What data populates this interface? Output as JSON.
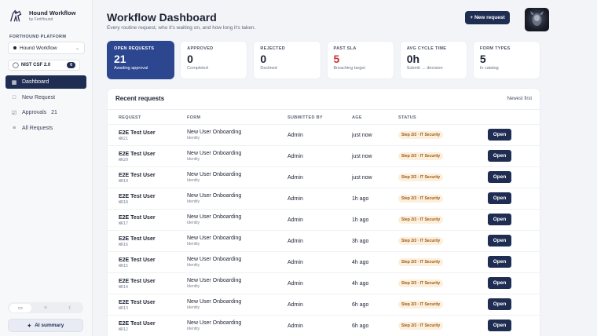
{
  "brand": {
    "name": "Hound Workflow",
    "sub": "by FortHound"
  },
  "sidebar": {
    "section_label": "FORTHOUND PLATFORM",
    "platform_select": "Hound Workflow",
    "nist": {
      "label": "NIST CSF 2.0",
      "badge": "6"
    },
    "items": [
      {
        "label": "Dashboard",
        "icon": "grid-icon"
      },
      {
        "label": "New Request",
        "icon": "document-plus-icon"
      },
      {
        "label": "Approvals",
        "count": "21",
        "icon": "check-box-icon"
      },
      {
        "label": "All Requests",
        "icon": "list-icon"
      }
    ],
    "ai_summary": "AI summary"
  },
  "header": {
    "title": "Workflow Dashboard",
    "subtitle": "Every routine request, who it's waiting on, and how long it's taken.",
    "new_request": "+ New request"
  },
  "cards": [
    {
      "label": "OPEN REQUESTS",
      "value": "21",
      "sub": "Awaiting approval"
    },
    {
      "label": "APPROVED",
      "value": "0",
      "sub": "Completed"
    },
    {
      "label": "REJECTED",
      "value": "0",
      "sub": "Declined"
    },
    {
      "label": "PAST SLA",
      "value": "5",
      "sub": "Breaching target"
    },
    {
      "label": "AVG CYCLE TIME",
      "value": "0h",
      "sub": "Submit → decision"
    },
    {
      "label": "FORM TYPES",
      "value": "5",
      "sub": "In catalog"
    }
  ],
  "table": {
    "title": "Recent requests",
    "sort": "Newest first",
    "columns": [
      "REQUEST",
      "FORM",
      "SUBMITTED BY",
      "AGE",
      "STATUS"
    ],
    "open_label": "Open",
    "rows": [
      {
        "name": "E2E Test User",
        "id": "WR21",
        "form": "New User Onboarding",
        "category": "Identity",
        "by": "Admin",
        "age": "just now",
        "status": "Step 2/3 · IT Security"
      },
      {
        "name": "E2E Test User",
        "id": "WR20",
        "form": "New User Onboarding",
        "category": "Identity",
        "by": "Admin",
        "age": "just now",
        "status": "Step 2/3 · IT Security"
      },
      {
        "name": "E2E Test User",
        "id": "WR19",
        "form": "New User Onboarding",
        "category": "Identity",
        "by": "Admin",
        "age": "just now",
        "status": "Step 2/3 · IT Security"
      },
      {
        "name": "E2E Test User",
        "id": "WR18",
        "form": "New User Onboarding",
        "category": "Identity",
        "by": "Admin",
        "age": "1h ago",
        "status": "Step 2/3 · IT Security"
      },
      {
        "name": "E2E Test User",
        "id": "WR17",
        "form": "New User Onboarding",
        "category": "Identity",
        "by": "Admin",
        "age": "1h ago",
        "status": "Step 2/3 · IT Security"
      },
      {
        "name": "E2E Test User",
        "id": "WR16",
        "form": "New User Onboarding",
        "category": "Identity",
        "by": "Admin",
        "age": "3h ago",
        "status": "Step 2/3 · IT Security"
      },
      {
        "name": "E2E Test User",
        "id": "WR15",
        "form": "New User Onboarding",
        "category": "Identity",
        "by": "Admin",
        "age": "4h ago",
        "status": "Step 2/3 · IT Security"
      },
      {
        "name": "E2E Test User",
        "id": "WR14",
        "form": "New User Onboarding",
        "category": "Identity",
        "by": "Admin",
        "age": "4h ago",
        "status": "Step 2/3 · IT Security"
      },
      {
        "name": "E2E Test User",
        "id": "WR13",
        "form": "New User Onboarding",
        "category": "Identity",
        "by": "Admin",
        "age": "6h ago",
        "status": "Step 2/3 · IT Security"
      },
      {
        "name": "E2E Test User",
        "id": "WR12",
        "form": "New User Onboarding",
        "category": "Identity",
        "by": "Admin",
        "age": "6h ago",
        "status": "Step 2/3 · IT Security"
      }
    ]
  },
  "colors": {
    "primary": "#1f2d52",
    "card_highlight": "#2c4790",
    "danger": "#c8322e",
    "status_bg": "#fcefdc"
  }
}
